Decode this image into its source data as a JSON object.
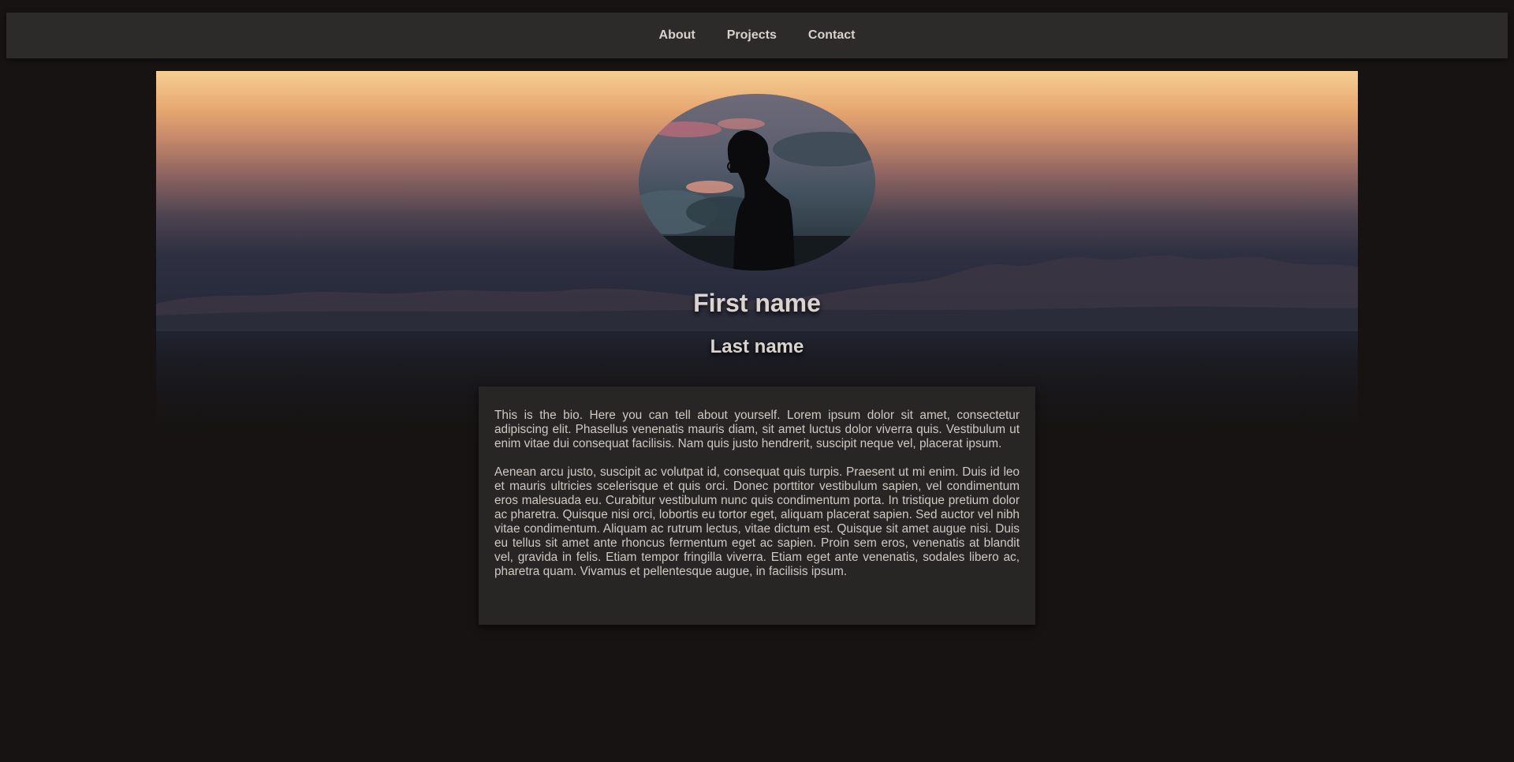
{
  "nav": {
    "items": [
      {
        "label": "About"
      },
      {
        "label": "Projects"
      },
      {
        "label": "Contact"
      }
    ]
  },
  "profile": {
    "first_name": "First name",
    "last_name": "Last name",
    "avatar_icon": "silhouette-portrait-icon"
  },
  "bio": {
    "paragraphs": [
      "This is the bio. Here you can tell about yourself. Lorem ipsum dolor sit amet, consectetur adipiscing elit. Phasellus venenatis mauris diam, sit amet luctus dolor viverra quis. Vestibulum ut enim vitae dui consequat facilisis. Nam quis justo hendrerit, suscipit neque vel, placerat ipsum.",
      "Aenean arcu justo, suscipit ac volutpat id, consequat quis turpis. Praesent ut mi enim. Duis id leo et mauris ultricies scelerisque et quis orci. Donec porttitor vestibulum sapien, vel condimentum eros malesuada eu. Curabitur vestibulum nunc quis condimentum porta. In tristique pretium dolor ac pharetra. Quisque nisi orci, lobortis eu tortor eget, aliquam placerat sapien. Sed auctor vel nibh vitae condimentum. Aliquam ac rutrum lectus, vitae dictum est. Quisque sit amet augue nisi. Duis eu tellus sit amet ante rhoncus fermentum eget ac sapien. Proin sem eros, venenatis at blandit vel, gravida in felis. Etiam tempor fringilla viverra. Etiam eget ante venenatis, sodales libero ac, pharetra quam. Vivamus et pellentesque augue, in facilisis ipsum."
    ]
  },
  "colors": {
    "page_background": "#161312",
    "navbar_background": "#2d2b2a",
    "card_background": "#282625",
    "text": "#d7d2cc"
  }
}
